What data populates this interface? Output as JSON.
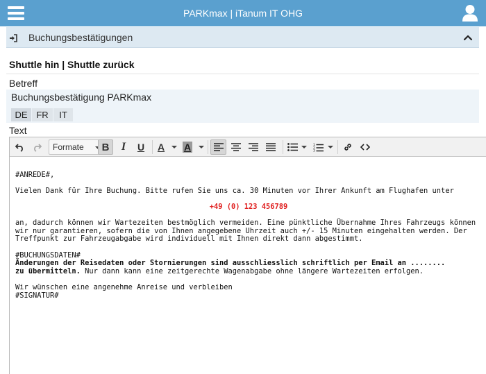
{
  "header": {
    "app_title": "PARKmax | iTanum IT OHG",
    "menu_icon": "hamburger-menu-icon",
    "user_icon": "user-icon",
    "bg_color": "#5aa0cf"
  },
  "panel": {
    "title": "Buchungsbestätigungen",
    "leading_icon": "sign-in-icon",
    "collapse_icon": "chevron-up-icon"
  },
  "section": {
    "heading": "Shuttle hin | Shuttle zurück"
  },
  "form": {
    "subject_label": "Betreff",
    "subject_value": "Buchungsbestätigung  PARKmax",
    "languages": [
      "DE",
      "FR",
      "IT"
    ],
    "selected_language": "DE",
    "text_label": "Text"
  },
  "toolbar": {
    "undo_icon": "undo-icon",
    "redo_icon": "redo-icon",
    "formats_label": "Formate",
    "bold_label": "B",
    "italic_label": "I",
    "underline_label": "U",
    "text_color_label": "A",
    "background_color_label": "A",
    "align_left_icon": "align-left-icon",
    "align_center_icon": "align-center-icon",
    "align_right_icon": "align-right-icon",
    "align_justify_icon": "align-justify-icon",
    "bullet_list_icon": "bullet-list-icon",
    "numbered_list_icon": "numbered-list-icon",
    "link_icon": "link-icon",
    "source_code_icon": "source-code-icon"
  },
  "content": {
    "salutation": "#ANREDE#,",
    "intro": "Vielen Dank für Ihre Buchung. Bitte rufen Sie uns ca. 30 Minuten vor Ihrer Ankunft am Flughafen unter",
    "phone": "+49 (0) 123 456789",
    "para_line1": "an, dadurch können wir  Wartezeiten bestmöglich vermeiden. Eine pünktliche Übernahme Ihres Fahrzeugs können",
    "para_line2": "wir nur garantieren, sofern die von Ihnen angegebene Uhrzeit auch +/- 15 Minuten eingehalten werden. Der",
    "para_line3": "Treffpunkt zur Fahrzeugabgabe wird individuell mit Ihnen direkt dann abgestimmt.",
    "booking_placeholder": "#BUCHUNGSDATEN#",
    "notice_bold_line1": "Änderungen der Reisedaten oder Stornierungen sind ausschliesslich schriftlich per Email an ........",
    "notice_bold_line2": "zu übermitteln.",
    "notice_rest": " Nur dann kann eine zeitgerechte Wagenabgabe ohne längere Wartezeiten erfolgen.",
    "closing": "Wir wünschen eine angenehme Anreise und verbleiben",
    "signature_placeholder": "#SIGNATUR#",
    "phone_color": "#e02020"
  }
}
